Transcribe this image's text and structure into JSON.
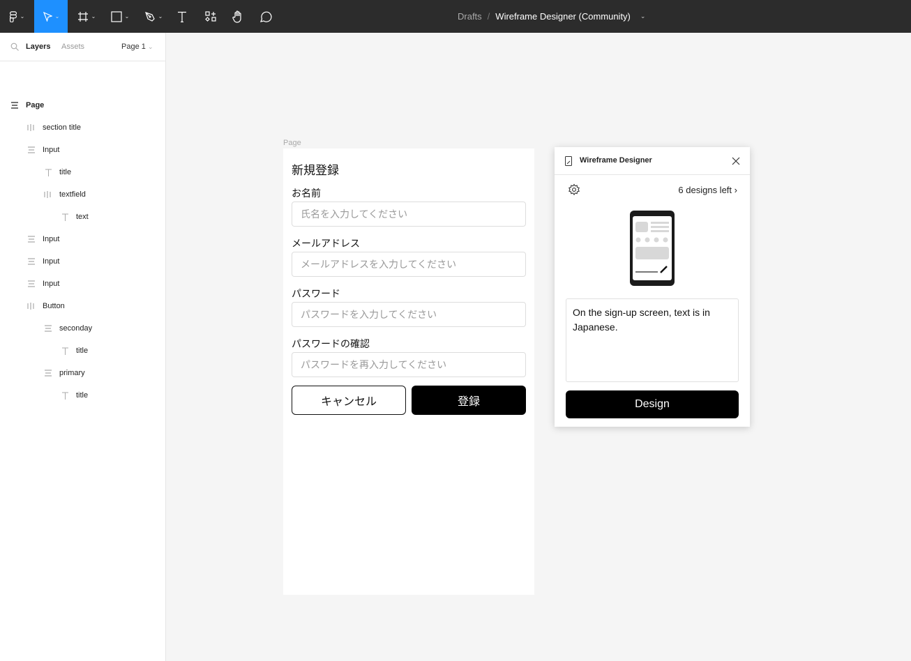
{
  "toolbar": {
    "tools": [
      "main-menu",
      "move",
      "frame",
      "shape",
      "pen",
      "text",
      "resources",
      "hand",
      "comment"
    ],
    "active": "move"
  },
  "breadcrumb": {
    "folder": "Drafts",
    "separator": "/",
    "file": "Wireframe Designer (Community)"
  },
  "sidebar": {
    "tabs": {
      "layers": "Layers",
      "assets": "Assets"
    },
    "page_select": "Page 1",
    "layers": [
      {
        "label": "Page",
        "level": 0,
        "icon": "auto-layout-vertical-icon"
      },
      {
        "label": "section title",
        "level": 1,
        "icon": "auto-layout-horizontal-icon"
      },
      {
        "label": "Input",
        "level": 1,
        "icon": "auto-layout-vertical-icon"
      },
      {
        "label": "title",
        "level": 2,
        "icon": "text-icon"
      },
      {
        "label": "textfield",
        "level": 2,
        "icon": "auto-layout-horizontal-icon"
      },
      {
        "label": "text",
        "level": 3,
        "icon": "text-icon"
      },
      {
        "label": "Input",
        "level": 1,
        "icon": "auto-layout-vertical-icon"
      },
      {
        "label": "Input",
        "level": 1,
        "icon": "auto-layout-vertical-icon"
      },
      {
        "label": "Input",
        "level": 1,
        "icon": "auto-layout-vertical-icon"
      },
      {
        "label": "Button",
        "level": 1,
        "icon": "auto-layout-horizontal-icon"
      },
      {
        "label": "seconday",
        "level": 2,
        "icon": "auto-layout-vertical-icon"
      },
      {
        "label": "title",
        "level": 3,
        "icon": "text-icon"
      },
      {
        "label": "primary",
        "level": 2,
        "icon": "auto-layout-vertical-icon"
      },
      {
        "label": "title",
        "level": 3,
        "icon": "text-icon"
      }
    ]
  },
  "canvas": {
    "frame_label": "Page",
    "form": {
      "title": "新規登録",
      "fields": [
        {
          "label": "お名前",
          "placeholder": "氏名を入力してください"
        },
        {
          "label": "メールアドレス",
          "placeholder": "メールアドレスを入力してください"
        },
        {
          "label": "パスワード",
          "placeholder": "パスワードを入力してください"
        },
        {
          "label": "パスワードの確認",
          "placeholder": "パスワードを再入力してください"
        }
      ],
      "cancel": "キャンセル",
      "submit": "登録"
    }
  },
  "plugin": {
    "title": "Wireframe Designer",
    "designs_left": "6 designs left",
    "prompt": "On the sign-up screen, text is in Japanese.",
    "design_button": "Design"
  }
}
